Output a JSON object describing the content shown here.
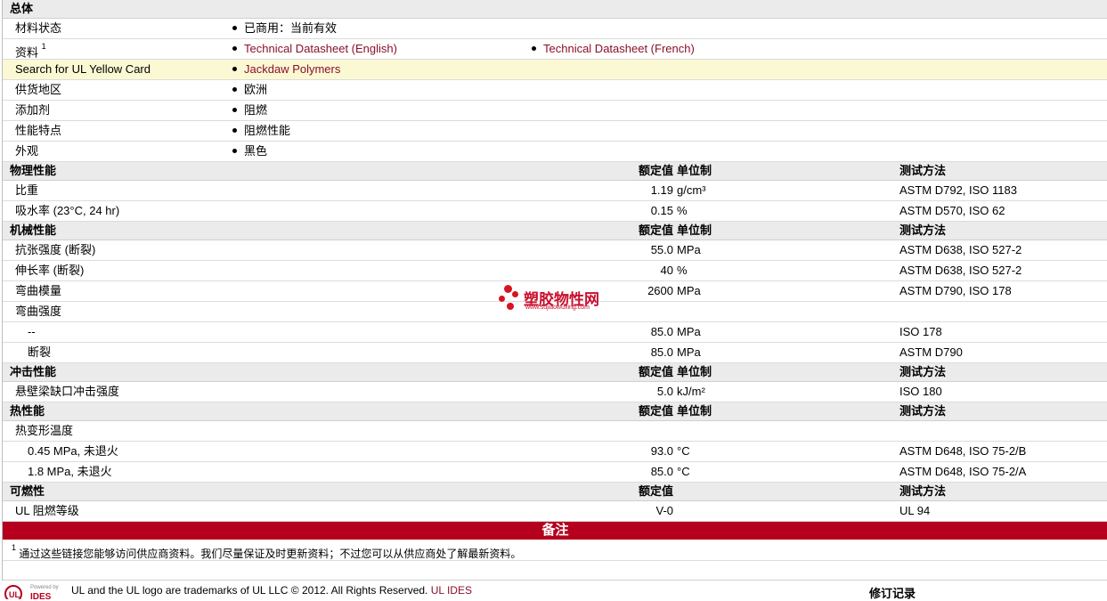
{
  "general": {
    "title": "总体",
    "material_status_label": "材料状态",
    "material_status_value": "已商用：当前有效",
    "datasheet_label": "资料",
    "datasheet_sup": "1",
    "datasheet_en": "Technical Datasheet (English)",
    "datasheet_fr": "Technical Datasheet (French)",
    "ul_label": "Search for UL Yellow Card",
    "ul_link": "Jackdaw Polymers",
    "region_label": "供货地区",
    "region_value": "欧洲",
    "additive_label": "添加剂",
    "additive_value": "阻燃",
    "feature_label": "性能特点",
    "feature_value": "阻燃性能",
    "appearance_label": "外观",
    "appearance_value": "黑色"
  },
  "headers": {
    "rated": "额定值",
    "unit": "单位制",
    "test": "测试方法"
  },
  "physical": {
    "title": "物理性能",
    "rows": [
      {
        "label": "比重",
        "value": "1.19",
        "unit": "g/cm³",
        "test": "ASTM D792, ISO 1183"
      },
      {
        "label": "吸水率  (23°C, 24 hr)",
        "value": "0.15",
        "unit": "%",
        "test": "ASTM D570, ISO 62"
      }
    ]
  },
  "mechanical": {
    "title": "机械性能",
    "rows": [
      {
        "label": "抗张强度  (断裂)",
        "value": "55.0",
        "unit": "MPa",
        "test": "ASTM D638, ISO 527-2"
      },
      {
        "label": "伸长率  (断裂)",
        "value": "40",
        "unit": "%",
        "test": "ASTM D638, ISO 527-2"
      },
      {
        "label": "弯曲模量",
        "value": "2600",
        "unit": "MPa",
        "test": "ASTM D790, ISO 178"
      }
    ],
    "flex_strength_label": "弯曲强度",
    "sub_rows": [
      {
        "label": "--",
        "value": "85.0",
        "unit": "MPa",
        "test": "ISO 178"
      },
      {
        "label": "断裂",
        "value": "85.0",
        "unit": "MPa",
        "test": "ASTM D790"
      }
    ]
  },
  "impact": {
    "title": "冲击性能",
    "rows": [
      {
        "label": "悬壁梁缺口冲击强度",
        "value": "5.0",
        "unit": "kJ/m²",
        "test": "ISO 180"
      }
    ]
  },
  "thermal": {
    "title": "热性能",
    "hdt_label": "热变形温度",
    "sub_rows": [
      {
        "label": "0.45 MPa, 未退火",
        "value": "93.0",
        "unit": "°C",
        "test": "ASTM D648, ISO 75-2/B"
      },
      {
        "label": "1.8 MPa, 未退火",
        "value": "85.0",
        "unit": "°C",
        "test": "ASTM D648, ISO 75-2/A"
      }
    ]
  },
  "flammability": {
    "title": "可燃性",
    "rows": [
      {
        "label": "UL 阻燃等级",
        "value": "V-0",
        "unit": "",
        "test": "UL 94"
      }
    ]
  },
  "notes": {
    "title": "备注",
    "sup": "1",
    "text": "通过这些链接您能够访问供应商资料。我们尽量保证及时更新资料；不过您可以从供应商处了解最新资料。"
  },
  "footer": {
    "powered_by": "Powered by",
    "ides": "IDES",
    "text": "UL and the UL logo are trademarks of UL LLC © 2012. All Rights Reserved.",
    "link": "UL IDES",
    "revision": "修订记录"
  },
  "watermark": {
    "title": "塑胶物性网",
    "url": "www.sujiaowuxing.com"
  },
  "colors": {
    "link": "#8a1028",
    "notes_bar": "#b5011e",
    "highlight_row": "#fbf8d4",
    "section_bg": "#ebebeb"
  }
}
